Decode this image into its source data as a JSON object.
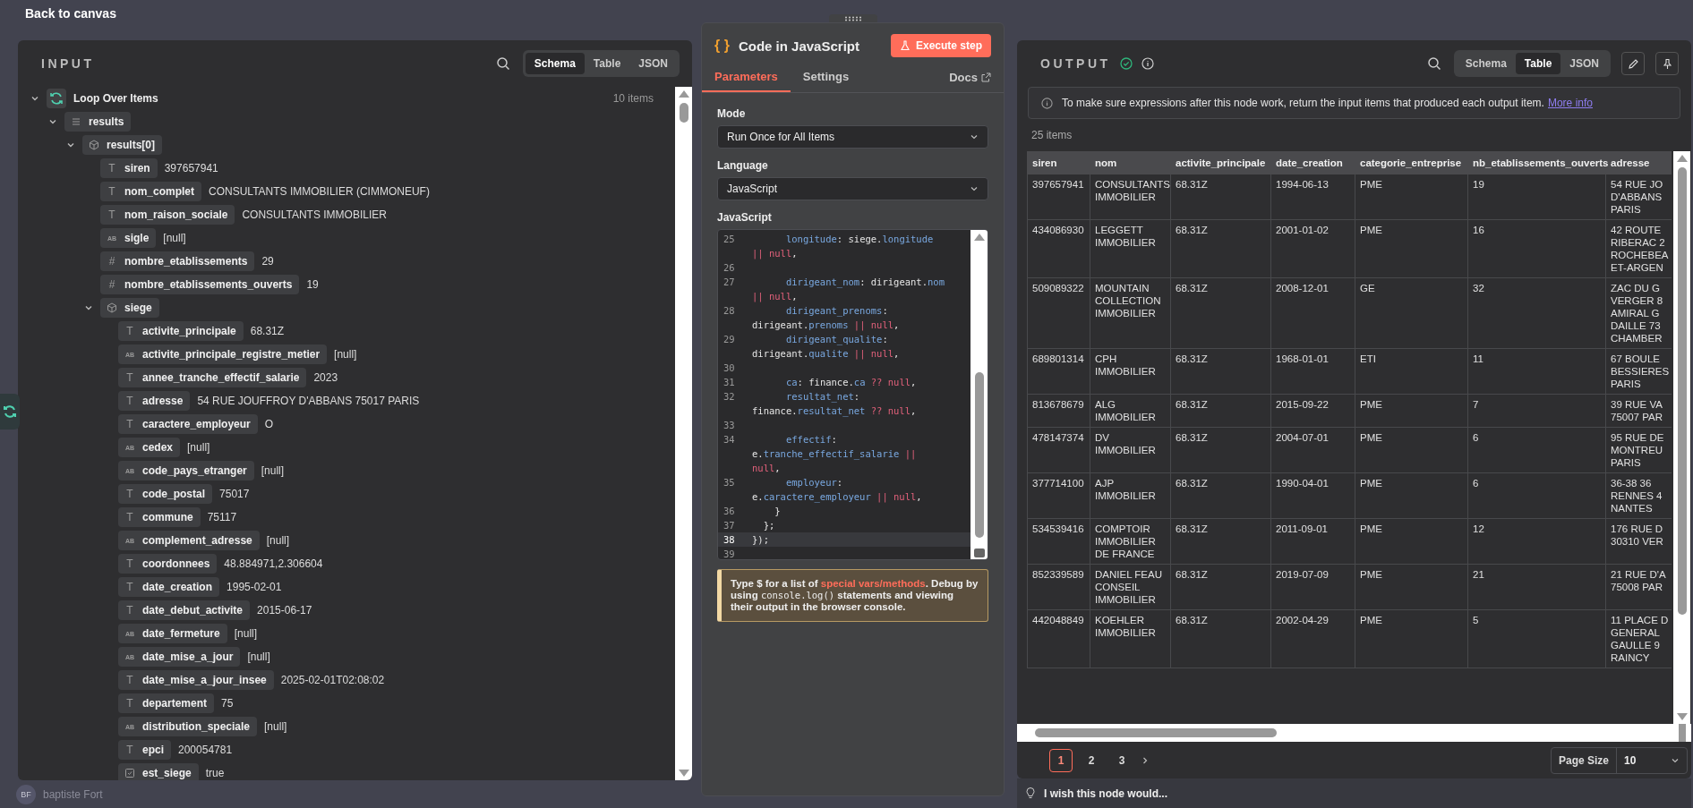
{
  "top_bar": {
    "back_link": "Back to canvas"
  },
  "input_panel": {
    "title": "INPUT",
    "view_tabs": [
      {
        "label": "Schema",
        "selected": true
      },
      {
        "label": "Table",
        "selected": false
      },
      {
        "label": "JSON",
        "selected": false
      }
    ],
    "tree": [
      {
        "kind": "loop",
        "key": "Loop Over Items",
        "count": "10 items",
        "expanded": true,
        "children": [
          {
            "kind": "array",
            "key": "results",
            "expanded": true,
            "children": [
              {
                "kind": "object",
                "key": "results[0]",
                "expanded": true,
                "children": [
                  {
                    "kind": "glyph",
                    "icon": "T",
                    "key": "siren",
                    "value": "397657941"
                  },
                  {
                    "kind": "glyph",
                    "icon": "T",
                    "key": "nom_complet",
                    "value": "CONSULTANTS IMMOBILIER (CIMMONEUF)"
                  },
                  {
                    "kind": "glyph",
                    "icon": "T",
                    "key": "nom_raison_sociale",
                    "value": "CONSULTANTS IMMOBILIER"
                  },
                  {
                    "kind": "glyph",
                    "icon": "AB",
                    "key": "sigle",
                    "value": "[null]"
                  },
                  {
                    "kind": "glyph",
                    "icon": "#",
                    "key": "nombre_etablissements",
                    "value": "29"
                  },
                  {
                    "kind": "glyph",
                    "icon": "#",
                    "key": "nombre_etablissements_ouverts",
                    "value": "19"
                  },
                  {
                    "kind": "object",
                    "key": "siege",
                    "expanded": true,
                    "children": [
                      {
                        "kind": "glyph",
                        "icon": "T",
                        "key": "activite_principale",
                        "value": "68.31Z"
                      },
                      {
                        "kind": "glyph",
                        "icon": "AB",
                        "key": "activite_principale_registre_metier",
                        "value": "[null]"
                      },
                      {
                        "kind": "glyph",
                        "icon": "T",
                        "key": "annee_tranche_effectif_salarie",
                        "value": "2023"
                      },
                      {
                        "kind": "glyph",
                        "icon": "T",
                        "key": "adresse",
                        "value": "54 RUE JOUFFROY D'ABBANS 75017 PARIS"
                      },
                      {
                        "kind": "glyph",
                        "icon": "T",
                        "key": "caractere_employeur",
                        "value": "O"
                      },
                      {
                        "kind": "glyph",
                        "icon": "AB",
                        "key": "cedex",
                        "value": "[null]"
                      },
                      {
                        "kind": "glyph",
                        "icon": "AB",
                        "key": "code_pays_etranger",
                        "value": "[null]"
                      },
                      {
                        "kind": "glyph",
                        "icon": "T",
                        "key": "code_postal",
                        "value": "75017"
                      },
                      {
                        "kind": "glyph",
                        "icon": "T",
                        "key": "commune",
                        "value": "75117"
                      },
                      {
                        "kind": "glyph",
                        "icon": "AB",
                        "key": "complement_adresse",
                        "value": "[null]"
                      },
                      {
                        "kind": "glyph",
                        "icon": "T",
                        "key": "coordonnees",
                        "value": "48.884971,2.306604"
                      },
                      {
                        "kind": "glyph",
                        "icon": "T",
                        "key": "date_creation",
                        "value": "1995-02-01"
                      },
                      {
                        "kind": "glyph",
                        "icon": "T",
                        "key": "date_debut_activite",
                        "value": "2015-06-17"
                      },
                      {
                        "kind": "glyph",
                        "icon": "AB",
                        "key": "date_fermeture",
                        "value": "[null]"
                      },
                      {
                        "kind": "glyph",
                        "icon": "AB",
                        "key": "date_mise_a_jour",
                        "value": "[null]"
                      },
                      {
                        "kind": "glyph",
                        "icon": "T",
                        "key": "date_mise_a_jour_insee",
                        "value": "2025-02-01T02:08:02"
                      },
                      {
                        "kind": "glyph",
                        "icon": "T",
                        "key": "departement",
                        "value": "75"
                      },
                      {
                        "kind": "glyph",
                        "icon": "AB",
                        "key": "distribution_speciale",
                        "value": "[null]"
                      },
                      {
                        "kind": "glyph",
                        "icon": "T",
                        "key": "epci",
                        "value": "200054781"
                      },
                      {
                        "kind": "boolean",
                        "key": "est_siege",
                        "value": "true"
                      }
                    ]
                  }
                ]
              }
            ]
          }
        ]
      }
    ]
  },
  "node_panel": {
    "title_icon": "{ }",
    "title": "Code in JavaScript",
    "execute_button": "Execute step",
    "tabs": [
      {
        "label": "Parameters",
        "selected": true
      },
      {
        "label": "Settings",
        "selected": false
      }
    ],
    "docs_link": "Docs",
    "fields": [
      {
        "label": "Mode",
        "value": "Run Once for All Items"
      },
      {
        "label": "Language",
        "value": "JavaScript"
      }
    ],
    "code_label": "JavaScript",
    "code_lines": [
      {
        "num": "25",
        "active": false,
        "tokens": [
          {
            "text": "      longitude",
            "kind": "prop"
          },
          {
            "text": ": siege.",
            "kind": "plain"
          },
          {
            "text": "longitude",
            "kind": "prop"
          },
          {
            "text": " || null",
            "kind": "op"
          },
          {
            "text": ",",
            "kind": "plain"
          }
        ]
      },
      {
        "num": "26",
        "active": false
      },
      {
        "num": "27",
        "active": false,
        "tokens": [
          {
            "text": "      dirigeant_nom",
            "kind": "prop"
          },
          {
            "text": ": dirigeant.",
            "kind": "plain"
          },
          {
            "text": "nom",
            "kind": "prop"
          },
          {
            "text": " || null",
            "kind": "op"
          },
          {
            "text": ",",
            "kind": "plain"
          }
        ]
      },
      {
        "num": "28",
        "active": false,
        "tokens": [
          {
            "text": "      dirigeant_prenoms",
            "kind": "prop"
          },
          {
            "text": ": dirigeant.",
            "kind": "plain"
          },
          {
            "text": "prenoms",
            "kind": "prop"
          },
          {
            "text": " || null",
            "kind": "op"
          },
          {
            "text": ",",
            "kind": "plain"
          }
        ]
      },
      {
        "num": "29",
        "active": false,
        "tokens": [
          {
            "text": "      dirigeant_qualite",
            "kind": "prop"
          },
          {
            "text": ": dirigeant.",
            "kind": "plain"
          },
          {
            "text": "qualite",
            "kind": "prop"
          },
          {
            "text": " || null",
            "kind": "op"
          },
          {
            "text": ",",
            "kind": "plain"
          }
        ]
      },
      {
        "num": "30",
        "active": false
      },
      {
        "num": "31",
        "active": false,
        "tokens": [
          {
            "text": "      ca",
            "kind": "prop"
          },
          {
            "text": ": finance.",
            "kind": "plain"
          },
          {
            "text": "ca",
            "kind": "prop"
          },
          {
            "text": " ?? null",
            "kind": "op"
          },
          {
            "text": ",",
            "kind": "plain"
          }
        ]
      },
      {
        "num": "32",
        "active": false,
        "tokens": [
          {
            "text": "      resultat_net",
            "kind": "prop"
          },
          {
            "text": ": finance.",
            "kind": "plain"
          },
          {
            "text": "resultat_net",
            "kind": "prop"
          },
          {
            "text": " ?? null",
            "kind": "op"
          },
          {
            "text": ",",
            "kind": "plain"
          }
        ]
      },
      {
        "num": "33",
        "active": false
      },
      {
        "num": "34",
        "active": false,
        "tokens": [
          {
            "text": "      effectif",
            "kind": "prop"
          },
          {
            "text": ": e.",
            "kind": "plain"
          },
          {
            "text": "tranche_effectif_salarie",
            "kind": "prop"
          },
          {
            "text": " || null",
            "kind": "op"
          },
          {
            "text": ",",
            "kind": "plain"
          }
        ]
      },
      {
        "num": "35",
        "active": false,
        "tokens": [
          {
            "text": "      employeur",
            "kind": "prop"
          },
          {
            "text": ": e.",
            "kind": "plain"
          },
          {
            "text": "caractere_employeur",
            "kind": "prop"
          },
          {
            "text": " || null",
            "kind": "op"
          },
          {
            "text": ",",
            "kind": "plain"
          }
        ]
      },
      {
        "num": "36",
        "active": false,
        "tokens": [
          {
            "text": "    }",
            "kind": "plain"
          }
        ]
      },
      {
        "num": "37",
        "active": false,
        "tokens": [
          {
            "text": "  };",
            "kind": "plain"
          }
        ]
      },
      {
        "num": "38",
        "active": true,
        "tokens": [
          {
            "text": "});",
            "kind": "plain"
          }
        ]
      },
      {
        "num": "39",
        "active": false
      }
    ],
    "hint": {
      "before": "Type $ for a list of ",
      "link": "special vars/methods",
      "middle": ". Debug by using ",
      "code": "console.log()",
      "after": " statements and viewing their output in the browser console."
    }
  },
  "output_panel": {
    "title": "OUTPUT",
    "succeeded": true,
    "view_tabs": [
      {
        "label": "Schema",
        "selected": false
      },
      {
        "label": "Table",
        "selected": true
      },
      {
        "label": "JSON",
        "selected": false
      }
    ],
    "notice": {
      "text": "To make sure expressions after this node work, return the input items that produced each output item.",
      "link": "More info"
    },
    "item_count": "25 items",
    "table": {
      "columns": [
        "siren",
        "nom",
        "activite_principale",
        "date_creation",
        "categorie_entreprise",
        "nb_etablissements_ouverts",
        "adresse"
      ],
      "rows": [
        [
          "397657941",
          "CONSULTANTS IMMOBILIER",
          "68.31Z",
          "1994-06-13",
          "PME",
          "19",
          "54 RUE JO\nD'ABBANS\nPARIS"
        ],
        [
          "434086930",
          "LEGGETT IMMOBILIER",
          "68.31Z",
          "2001-01-02",
          "PME",
          "16",
          "42 ROUTE\nRIBERAC 2\nROCHEBEA\nET-ARGEN"
        ],
        [
          "509089322",
          "MOUNTAIN COLLECTION IMMOBILIER",
          "68.31Z",
          "2008-12-01",
          "GE",
          "32",
          "ZAC DU G\nVERGER 8\nAMIRAL G\nDAILLE 73\nCHAMBER"
        ],
        [
          "689801314",
          "CPH IMMOBILIER",
          "68.31Z",
          "1968-01-01",
          "ETI",
          "11",
          "67 BOULE\nBESSIERES\nPARIS"
        ],
        [
          "813678679",
          "ALG IMMOBILIER",
          "68.31Z",
          "2015-09-22",
          "PME",
          "7",
          "39 RUE VA\n75007 PAR"
        ],
        [
          "478147374",
          "DV IMMOBILIER",
          "68.31Z",
          "2004-07-01",
          "PME",
          "6",
          "95 RUE DE\nMONTREU\nPARIS"
        ],
        [
          "377714100",
          "AJP IMMOBILIER",
          "68.31Z",
          "1990-04-01",
          "PME",
          "6",
          "36-38 36\nRENNES 4\nNANTES"
        ],
        [
          "534539416",
          "COMPTOIR IMMOBILIER DE FRANCE",
          "68.31Z",
          "2011-09-01",
          "PME",
          "12",
          "176 RUE D\n30310 VER"
        ],
        [
          "852339589",
          "DANIEL FEAU CONSEIL IMMOBILIER",
          "68.31Z",
          "2019-07-09",
          "PME",
          "21",
          "21 RUE D'A\n75008 PAR"
        ],
        [
          "442048849",
          "KOEHLER IMMOBILIER",
          "68.31Z",
          "2002-04-29",
          "PME",
          "5",
          "11 PLACE D\nGENERAL\nGAULLE 9\nRAINCY"
        ]
      ]
    },
    "pagination": {
      "pages": [
        {
          "label": "1",
          "selected": true
        },
        {
          "label": "2",
          "selected": false
        },
        {
          "label": "3",
          "selected": false
        }
      ],
      "page_size_label": "Page Size",
      "page_size": "10"
    },
    "feedback": "I wish this node would..."
  },
  "canvas_user": {
    "initials": "BF",
    "name": "baptiste Fort"
  }
}
